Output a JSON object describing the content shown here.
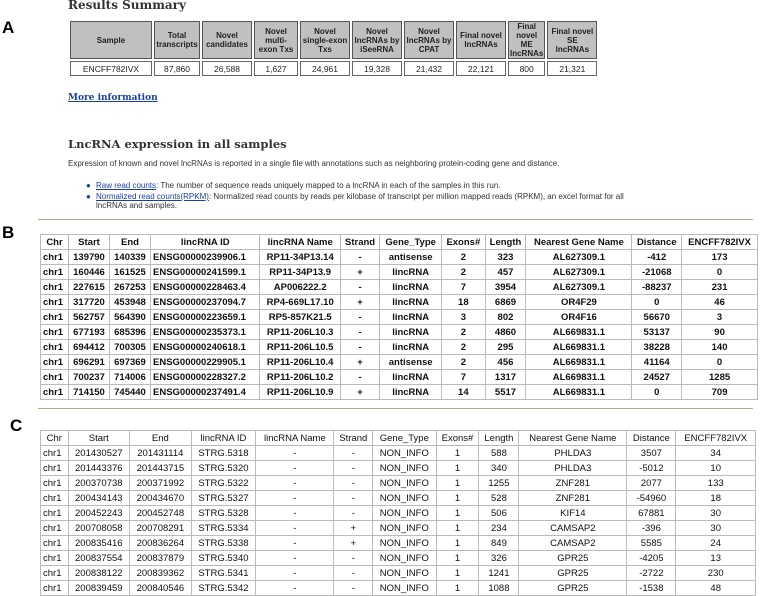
{
  "panels": {
    "a": "A",
    "b": "B",
    "c": "C"
  },
  "results_summary": {
    "title": "Results Summary",
    "headers": [
      "Sample",
      "Total transcripts",
      "Novel candidates",
      "Novel multi-exon Txs",
      "Novel single-exon Txs",
      "Novel lncRNAs by iSeeRNA",
      "Novel lncRNAs by CPAT",
      "Final novel lncRNAs",
      "Final novel ME lncRNAs",
      "Final novel SE lncRNAs"
    ],
    "row": [
      "ENCFF782IVX",
      "87,860",
      "26,588",
      "1,627",
      "24,961",
      "19,328",
      "21,432",
      "22,121",
      "800",
      "21,321"
    ]
  },
  "more_info": "More information",
  "lnc_section": {
    "title": "LncRNA expression in all samples",
    "description": "Expression of known and novel lncRNAs is reported in a single file with annotations such as neighboring protein-coding gene and distance.",
    "bullets": [
      {
        "link": "Raw read counts",
        "text": ": The number of sequence reads uniquely mapped to a lncRNA in each of the samples in this run."
      },
      {
        "link": "Normalized read counts(RPKM)",
        "text": ": Normalized read counts by reads per kilobase of transcript per million mapped reads (RPKM), an excel format for all lncRNAs and samples."
      }
    ]
  },
  "table_b": {
    "headers": [
      "Chr",
      "Start",
      "End",
      "lincRNA ID",
      "lincRNA Name",
      "Strand",
      "Gene_Type",
      "Exons#",
      "Length",
      "Nearest Gene Name",
      "Distance",
      "ENCFF782IVX"
    ],
    "rows": [
      [
        "chr1",
        "139790",
        "140339",
        "ENSG00000239906.1",
        "RP11-34P13.14",
        "-",
        "antisense",
        "2",
        "323",
        "AL627309.1",
        "-412",
        "173"
      ],
      [
        "chr1",
        "160446",
        "161525",
        "ENSG00000241599.1",
        "RP11-34P13.9",
        "+",
        "lincRNA",
        "2",
        "457",
        "AL627309.1",
        "-21068",
        "0"
      ],
      [
        "chr1",
        "227615",
        "267253",
        "ENSG00000228463.4",
        "AP006222.2",
        "-",
        "lincRNA",
        "7",
        "3954",
        "AL627309.1",
        "-88237",
        "231"
      ],
      [
        "chr1",
        "317720",
        "453948",
        "ENSG00000237094.7",
        "RP4-669L17.10",
        "+",
        "lincRNA",
        "18",
        "6869",
        "OR4F29",
        "0",
        "46"
      ],
      [
        "chr1",
        "562757",
        "564390",
        "ENSG00000223659.1",
        "RP5-857K21.5",
        "-",
        "lincRNA",
        "3",
        "802",
        "OR4F16",
        "56670",
        "3"
      ],
      [
        "chr1",
        "677193",
        "685396",
        "ENSG00000235373.1",
        "RP11-206L10.3",
        "-",
        "lincRNA",
        "2",
        "4860",
        "AL669831.1",
        "53137",
        "90"
      ],
      [
        "chr1",
        "694412",
        "700305",
        "ENSG00000240618.1",
        "RP11-206L10.5",
        "-",
        "lincRNA",
        "2",
        "295",
        "AL669831.1",
        "38228",
        "140"
      ],
      [
        "chr1",
        "696291",
        "697369",
        "ENSG00000229905.1",
        "RP11-206L10.4",
        "+",
        "antisense",
        "2",
        "456",
        "AL669831.1",
        "41164",
        "0"
      ],
      [
        "chr1",
        "700237",
        "714006",
        "ENSG00000228327.2",
        "RP11-206L10.2",
        "-",
        "lincRNA",
        "7",
        "1317",
        "AL669831.1",
        "24527",
        "1285"
      ],
      [
        "chr1",
        "714150",
        "745440",
        "ENSG00000237491.4",
        "RP11-206L10.9",
        "+",
        "lincRNA",
        "14",
        "5517",
        "AL669831.1",
        "0",
        "709"
      ]
    ]
  },
  "table_c": {
    "headers": [
      "Chr",
      "Start",
      "End",
      "lincRNA ID",
      "lincRNA Name",
      "Strand",
      "Gene_Type",
      "Exons#",
      "Length",
      "Nearest Gene Name",
      "Distance",
      "ENCFF782IVX"
    ],
    "rows": [
      [
        "chr1",
        "201430527",
        "201431114",
        "STRG.5318",
        "-",
        "-",
        "NON_INFO",
        "1",
        "588",
        "PHLDA3",
        "3507",
        "34"
      ],
      [
        "chr1",
        "201443376",
        "201443715",
        "STRG.5320",
        "-",
        "-",
        "NON_INFO",
        "1",
        "340",
        "PHLDA3",
        "-5012",
        "10"
      ],
      [
        "chr1",
        "200370738",
        "200371992",
        "STRG.5322",
        "-",
        "-",
        "NON_INFO",
        "1",
        "1255",
        "ZNF281",
        "2077",
        "133"
      ],
      [
        "chr1",
        "200434143",
        "200434670",
        "STRG.5327",
        "-",
        "-",
        "NON_INFO",
        "1",
        "528",
        "ZNF281",
        "-54960",
        "18"
      ],
      [
        "chr1",
        "200452243",
        "200452748",
        "STRG.5328",
        "-",
        "-",
        "NON_INFO",
        "1",
        "506",
        "KIF14",
        "67881",
        "30"
      ],
      [
        "chr1",
        "200708058",
        "200708291",
        "STRG.5334",
        "-",
        "+",
        "NON_INFO",
        "1",
        "234",
        "CAMSAP2",
        "-396",
        "30"
      ],
      [
        "chr1",
        "200835416",
        "200836264",
        "STRG.5338",
        "-",
        "+",
        "NON_INFO",
        "1",
        "849",
        "CAMSAP2",
        "5585",
        "24"
      ],
      [
        "chr1",
        "200837554",
        "200837879",
        "STRG.5340",
        "-",
        "-",
        "NON_INFO",
        "1",
        "326",
        "GPR25",
        "-4205",
        "13"
      ],
      [
        "chr1",
        "200838122",
        "200839362",
        "STRG.5341",
        "-",
        "-",
        "NON_INFO",
        "1",
        "1241",
        "GPR25",
        "-2722",
        "230"
      ],
      [
        "chr1",
        "200839459",
        "200840546",
        "STRG.5342",
        "-",
        "-",
        "NON_INFO",
        "1",
        "1088",
        "GPR25",
        "-1538",
        "48"
      ]
    ]
  }
}
